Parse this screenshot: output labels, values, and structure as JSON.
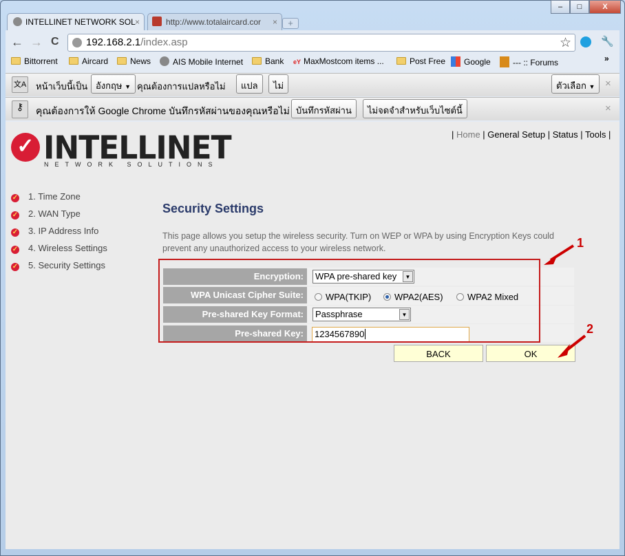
{
  "window": {
    "minimize": "–",
    "maximize": "□",
    "close": "X"
  },
  "tabs": [
    {
      "title": "INTELLINET NETWORK SOL",
      "close": "×"
    },
    {
      "title": "http://www.totalaircard.cor",
      "close": "×"
    }
  ],
  "new_tab": "+",
  "toolbar": {
    "back": "←",
    "forward": "→",
    "reload": "C",
    "url_host": "192.168.2.1",
    "url_path": "/index.asp",
    "star": "☆",
    "wrench": "🔧"
  },
  "bookmarks": [
    "Bittorrent",
    "Aircard",
    "News",
    "AIS Mobile Internet",
    "Bank",
    "MaxMostcom items ...",
    "Post Free",
    "Google",
    "--- :: Forums"
  ],
  "bookmarks_more": "»",
  "translate_bar": {
    "prefix": "หน้าเว็บนี้เป็น",
    "language": "อังกฤษ",
    "question": "คุณต้องการแปลหรือไม่",
    "translate": "แปล",
    "no": "ไม่",
    "options": "ตัวเลือก",
    "close": "×"
  },
  "password_bar": {
    "question": "คุณต้องการให้ Google Chrome บันทึกรหัสผ่านของคุณหรือไม่",
    "save": "บันทึกรหัสผ่าน",
    "never": "ไม่จดจำสำหรับเว็บไซต์นี้",
    "close": "×"
  },
  "logo": {
    "brand": "INTELLINET",
    "tagline": "NETWORK SOLUTIONS"
  },
  "top_nav": [
    "Home",
    "General Setup",
    "Status",
    "Tools"
  ],
  "sidebar": [
    "1. Time Zone",
    "2. WAN Type",
    "3. IP Address Info",
    "4. Wireless Settings",
    "5. Security Settings"
  ],
  "main": {
    "title": "Security Settings",
    "description": "This page allows you setup the wireless security. Turn on WEP or WPA by using Encryption Keys could prevent any unauthorized access to your wireless network.",
    "encryption_label": "Encryption:",
    "encryption_value": "WPA pre-shared key",
    "cipher_label": "WPA Unicast Cipher Suite:",
    "cipher_options": [
      "WPA(TKIP)",
      "WPA2(AES)",
      "WPA2 Mixed"
    ],
    "cipher_selected": "WPA2(AES)",
    "format_label": "Pre-shared Key Format:",
    "format_value": "Passphrase",
    "key_label": "Pre-shared Key:",
    "key_value": "1234567890",
    "back": "BACK",
    "ok": "OK"
  },
  "annotations": [
    "1",
    "2"
  ],
  "colors": {
    "annotation": "#cc0000",
    "label_bg": "#a6a6a6",
    "button_bg": "#ffffd6",
    "title": "#2a3a6a"
  }
}
